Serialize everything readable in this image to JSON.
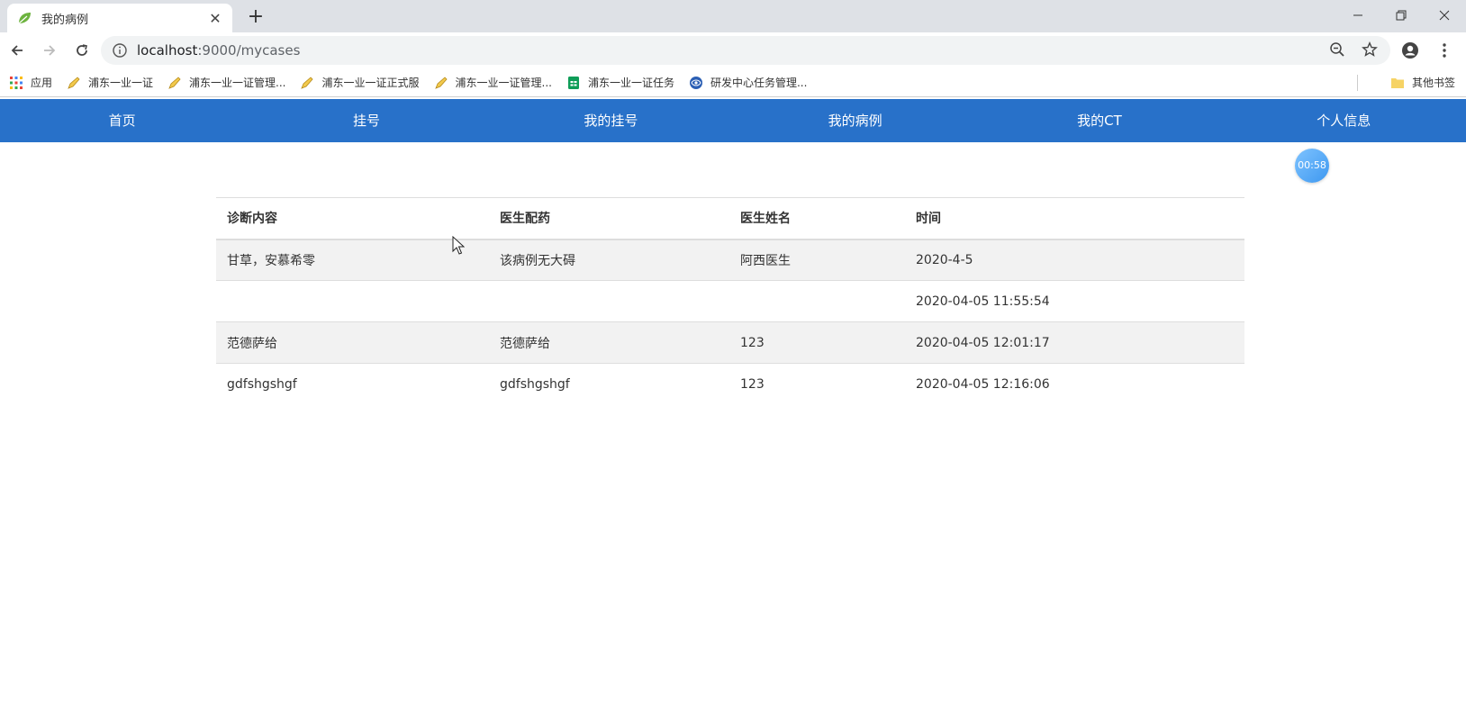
{
  "browser": {
    "tab_title": "我的病例",
    "url_host": "localhost",
    "url_rest": ":9000/mycases",
    "bookmarks": [
      {
        "label": "应用",
        "icon": "apps-grid-icon"
      },
      {
        "label": "浦东一业一证",
        "icon": "pen-icon"
      },
      {
        "label": "浦东一业一证管理...",
        "icon": "pen-icon"
      },
      {
        "label": "浦东一业一证正式服",
        "icon": "pen-icon"
      },
      {
        "label": "浦东一业一证管理...",
        "icon": "pen-icon"
      },
      {
        "label": "浦东一业一证任务",
        "icon": "sheet-icon"
      },
      {
        "label": "研发中心任务管理...",
        "icon": "globe-icon"
      }
    ],
    "other_bookmarks": "其他书签"
  },
  "nav": {
    "items": [
      "首页",
      "挂号",
      "我的挂号",
      "我的病例",
      "我的CT",
      "个人信息"
    ]
  },
  "timer": "00:58",
  "table": {
    "headers": [
      "诊断内容",
      "医生配药",
      "医生姓名",
      "时间"
    ],
    "rows": [
      [
        "甘草，安慕希零",
        "该病例无大碍",
        "阿西医生",
        "2020-4-5"
      ],
      [
        "",
        "",
        "",
        "2020-04-05 11:55:54"
      ],
      [
        "范德萨给",
        "范德萨给",
        "123",
        "2020-04-05 12:01:17"
      ],
      [
        "gdfshgshgf",
        "gdfshgshgf",
        "123",
        "2020-04-05 12:16:06"
      ]
    ]
  }
}
